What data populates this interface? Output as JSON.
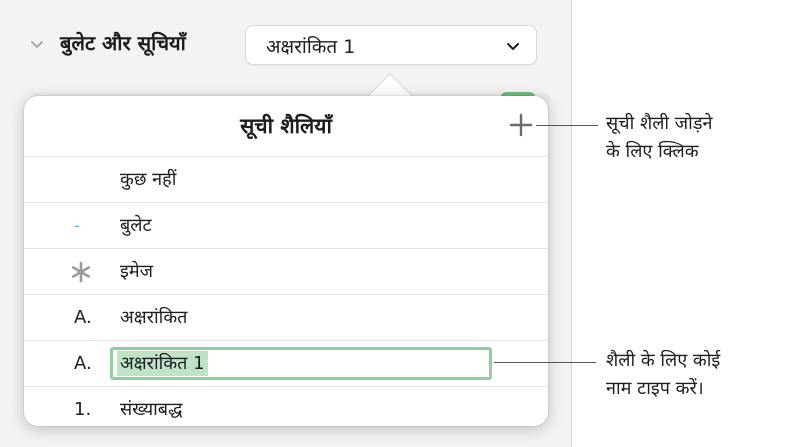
{
  "sidebar": {
    "section_title": "बुलेट और सूचियाँ",
    "style_dropdown_value": "अक्षरांकित 1"
  },
  "popover": {
    "title": "सूची शैलियाँ",
    "add_button_icon": "plus-icon",
    "items": [
      {
        "bullet": "",
        "label": "कुछ नहीं"
      },
      {
        "bullet": "-",
        "label": "बुलेट"
      },
      {
        "bullet": "image-asterisk-icon",
        "label": "इमेज"
      },
      {
        "bullet": "A.",
        "label": "अक्षरांकित"
      },
      {
        "bullet": "A.",
        "label": "अक्षरांकित 1",
        "editing": true
      },
      {
        "bullet": "1.",
        "label": "संख्याबद्ध"
      }
    ]
  },
  "callouts": {
    "add_style": "सूची शैली जोड़ने\nके लिए क्लिक",
    "type_name": "शैली के लिए कोई\nनाम टाइप करें।"
  },
  "colors": {
    "accent_green": "#8ecf9c",
    "selection_green": "#bfe3c7",
    "bullet_blue": "#5aa9e6"
  }
}
